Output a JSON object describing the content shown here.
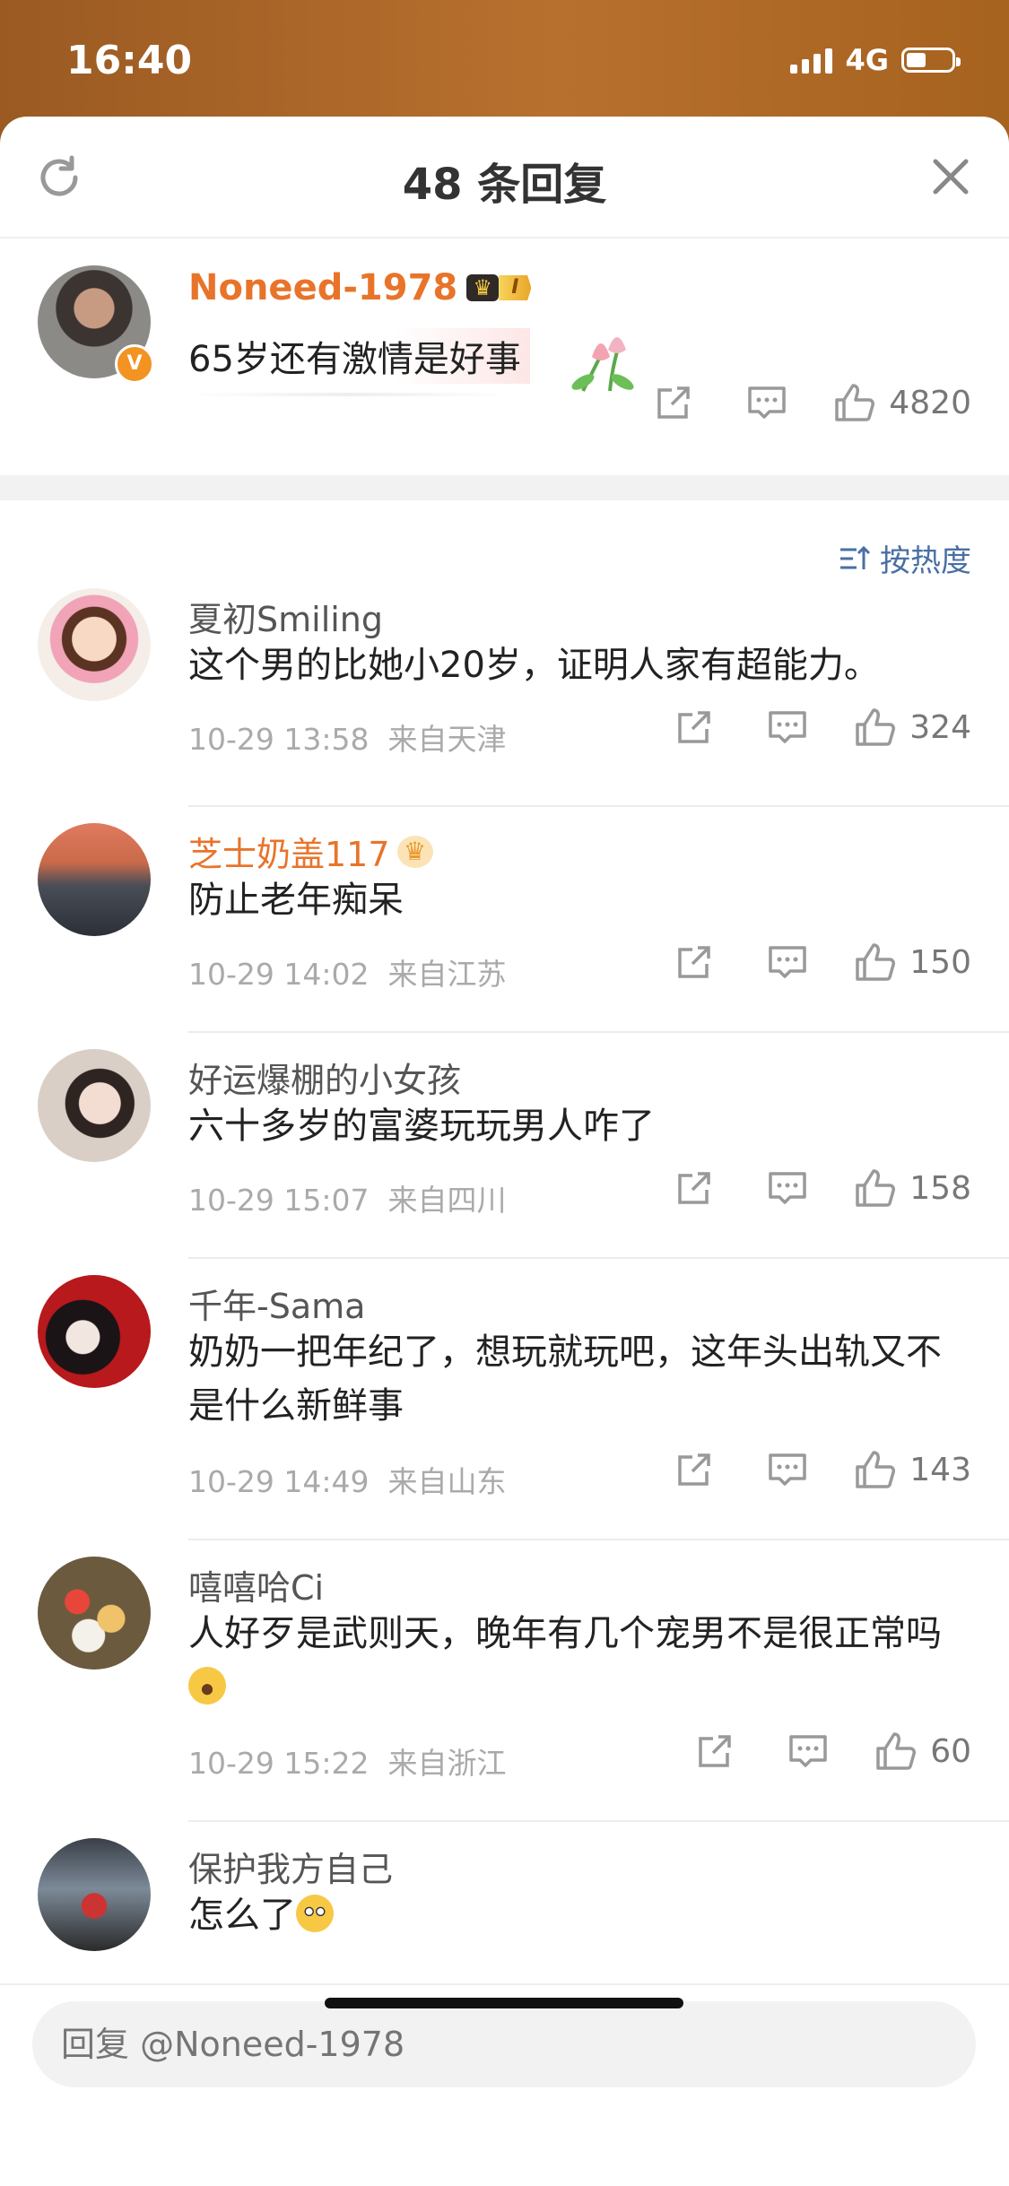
{
  "status": {
    "time": "16:40",
    "network": "4G"
  },
  "header": {
    "title": "48 条回复"
  },
  "main_comment": {
    "author": "Noneed-1978",
    "verified_badge": "V",
    "level_badge": "I",
    "text": "65岁还有激情是好事",
    "likes": "4820"
  },
  "sort": {
    "label": "按热度"
  },
  "comments": [
    {
      "author": "夏初Smiling",
      "author_color": "#555555",
      "text": "这个男的比她小20岁，证明人家有超能力。",
      "date": "10-29 13:58",
      "location": "来自天津",
      "likes": "324"
    },
    {
      "author": "芝士奶盖117",
      "author_color": "#e8742a",
      "text": "防止老年痴呆",
      "date": "10-29 14:02",
      "location": "来自江苏",
      "likes": "150"
    },
    {
      "author": "好运爆棚的小女孩",
      "author_color": "#555555",
      "text": "六十多岁的富婆玩玩男人咋了",
      "date": "10-29 15:07",
      "location": "来自四川",
      "likes": "158"
    },
    {
      "author": "千年-Sama",
      "author_color": "#555555",
      "text": "奶奶一把年纪了，想玩就玩吧，这年头出轨又不是什么新鲜事",
      "date": "10-29 14:49",
      "location": "来自山东",
      "likes": "143"
    },
    {
      "author": "嘻嘻哈Ci",
      "author_color": "#555555",
      "text": "人好歹是武则天，晚年有几个宠男不是很正常吗",
      "date": "10-29 15:22",
      "location": "来自浙江",
      "likes": "60"
    },
    {
      "author": "保护我方自己",
      "author_color": "#555555",
      "text": "怎么了"
    }
  ],
  "reply": {
    "placeholder": "回复 @Noneed-1978"
  }
}
